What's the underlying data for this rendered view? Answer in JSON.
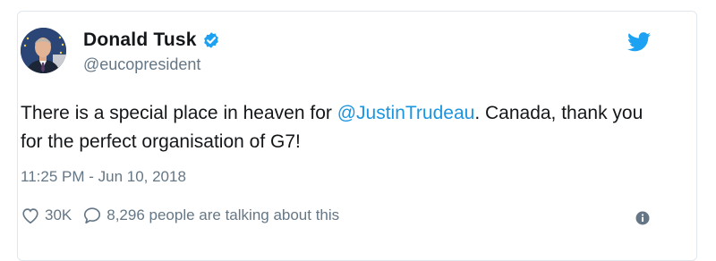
{
  "tweet": {
    "author_name": "Donald Tusk",
    "handle": "@eucopresident",
    "text_before_mention": "There is a special place in heaven for ",
    "mention": "@JustinTrudeau",
    "text_after_mention": ". Canada, thank you for the perfect organisation of G7!",
    "timestamp": "11:25 PM - Jun 10, 2018",
    "like_count": "30K",
    "talking_text": "8,296 people are talking about this"
  },
  "icons": {
    "avatar": "profile-photo",
    "verified": "verified-badge-icon",
    "brand": "twitter-bird-icon",
    "like": "heart-icon",
    "reply": "speech-bubble-icon",
    "info": "info-icon"
  },
  "colors": {
    "link": "#1b95e0",
    "verified": "#1da1f2",
    "text": "#14171a",
    "muted": "#657786",
    "border": "#e1e8ed"
  }
}
